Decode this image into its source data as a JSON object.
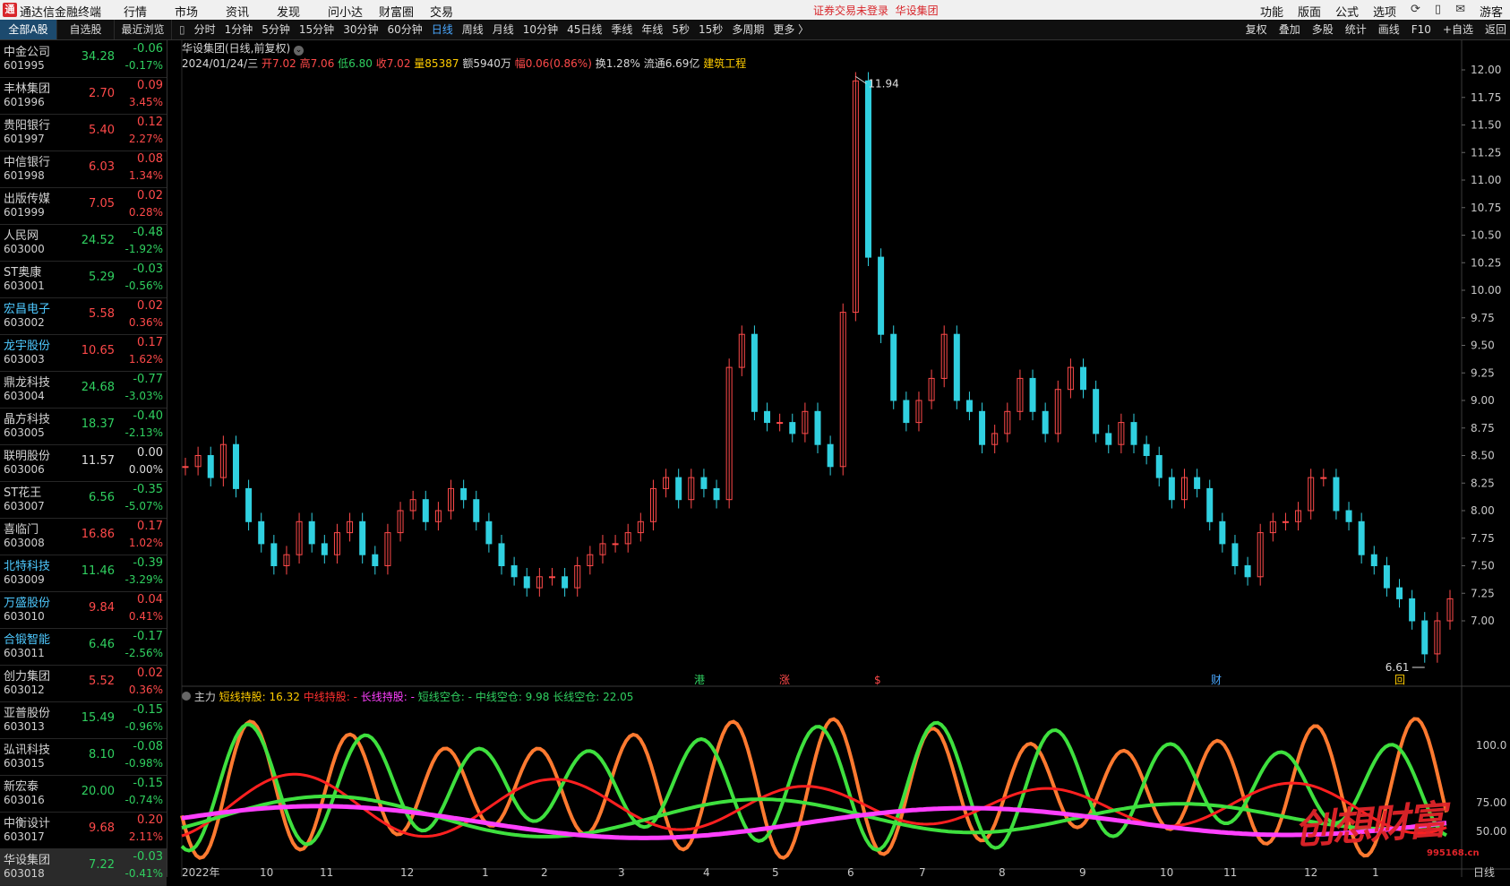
{
  "app_title": "通达信金融终端",
  "menu": [
    "行情",
    "市场",
    "资讯",
    "发现",
    "问小达",
    "财富圈",
    "交易"
  ],
  "login_notice": "证券交易未登录",
  "login_stock": "华设集团",
  "menu_right": [
    "功能",
    "版面",
    "公式",
    "选项"
  ],
  "guest_label": "游客",
  "tabs": [
    "全部A股",
    "自选股",
    "最近浏览"
  ],
  "periods": [
    "分时",
    "1分钟",
    "5分钟",
    "15分钟",
    "30分钟",
    "60分钟",
    "日线",
    "周线",
    "月线",
    "10分钟",
    "45日线",
    "季线",
    "年线",
    "5秒",
    "15秒",
    "多周期",
    "更多 〉"
  ],
  "active_period": "日线",
  "tools": [
    "复权",
    "叠加",
    "多股",
    "统计",
    "画线",
    "F10",
    "+自选",
    "返回"
  ],
  "stocks": [
    {
      "name": "中金公司",
      "code": "601995",
      "price": "34.28",
      "chg": "-0.06",
      "pct": "-0.17%",
      "dir": "dn",
      "hl": false
    },
    {
      "name": "丰林集团",
      "code": "601996",
      "price": "2.70",
      "chg": "0.09",
      "pct": "3.45%",
      "dir": "up",
      "hl": false
    },
    {
      "name": "贵阳银行",
      "code": "601997",
      "price": "5.40",
      "chg": "0.12",
      "pct": "2.27%",
      "dir": "up",
      "hl": false
    },
    {
      "name": "中信银行",
      "code": "601998",
      "price": "6.03",
      "chg": "0.08",
      "pct": "1.34%",
      "dir": "up",
      "hl": false
    },
    {
      "name": "出版传媒",
      "code": "601999",
      "price": "7.05",
      "chg": "0.02",
      "pct": "0.28%",
      "dir": "up",
      "hl": false
    },
    {
      "name": "人民网",
      "code": "603000",
      "price": "24.52",
      "chg": "-0.48",
      "pct": "-1.92%",
      "dir": "dn",
      "hl": false
    },
    {
      "name": "ST奥康",
      "code": "603001",
      "price": "5.29",
      "chg": "-0.03",
      "pct": "-0.56%",
      "dir": "dn",
      "hl": false
    },
    {
      "name": "宏昌电子",
      "code": "603002",
      "price": "5.58",
      "chg": "0.02",
      "pct": "0.36%",
      "dir": "up",
      "hl": true
    },
    {
      "name": "龙宇股份",
      "code": "603003",
      "price": "10.65",
      "chg": "0.17",
      "pct": "1.62%",
      "dir": "up",
      "hl": true
    },
    {
      "name": "鼎龙科技",
      "code": "603004",
      "price": "24.68",
      "chg": "-0.77",
      "pct": "-3.03%",
      "dir": "dn",
      "hl": false
    },
    {
      "name": "晶方科技",
      "code": "603005",
      "price": "18.37",
      "chg": "-0.40",
      "pct": "-2.13%",
      "dir": "dn",
      "hl": false
    },
    {
      "name": "联明股份",
      "code": "603006",
      "price": "11.57",
      "chg": "0.00",
      "pct": "0.00%",
      "dir": "fl",
      "hl": false
    },
    {
      "name": "ST花王",
      "code": "603007",
      "price": "6.56",
      "chg": "-0.35",
      "pct": "-5.07%",
      "dir": "dn",
      "hl": false
    },
    {
      "name": "喜临门",
      "code": "603008",
      "price": "16.86",
      "chg": "0.17",
      "pct": "1.02%",
      "dir": "up",
      "hl": false
    },
    {
      "name": "北特科技",
      "code": "603009",
      "price": "11.46",
      "chg": "-0.39",
      "pct": "-3.29%",
      "dir": "dn",
      "hl": true
    },
    {
      "name": "万盛股份",
      "code": "603010",
      "price": "9.84",
      "chg": "0.04",
      "pct": "0.41%",
      "dir": "up",
      "hl": true
    },
    {
      "name": "合锻智能",
      "code": "603011",
      "price": "6.46",
      "chg": "-0.17",
      "pct": "-2.56%",
      "dir": "dn",
      "hl": true
    },
    {
      "name": "创力集团",
      "code": "603012",
      "price": "5.52",
      "chg": "0.02",
      "pct": "0.36%",
      "dir": "up",
      "hl": false
    },
    {
      "name": "亚普股份",
      "code": "603013",
      "price": "15.49",
      "chg": "-0.15",
      "pct": "-0.96%",
      "dir": "dn",
      "hl": false
    },
    {
      "name": "弘讯科技",
      "code": "603015",
      "price": "8.10",
      "chg": "-0.08",
      "pct": "-0.98%",
      "dir": "dn",
      "hl": false
    },
    {
      "name": "新宏泰",
      "code": "603016",
      "price": "20.00",
      "chg": "-0.15",
      "pct": "-0.74%",
      "dir": "dn",
      "hl": false
    },
    {
      "name": "中衡设计",
      "code": "603017",
      "price": "9.68",
      "chg": "0.20",
      "pct": "2.11%",
      "dir": "up",
      "hl": false
    },
    {
      "name": "华设集团",
      "code": "603018",
      "price": "7.22",
      "chg": "-0.03",
      "pct": "-0.41%",
      "dir": "dn",
      "hl": false
    }
  ],
  "chart_header": "华设集团(日线,前复权)",
  "quote": {
    "date": "2024/01/24/三",
    "open": "开7.02",
    "high": "高7.06",
    "low": "低6.80",
    "close": "收7.02",
    "vol": "量85387",
    "amt": "额5940万",
    "amp": "幅0.06(0.86%)",
    "turn": "换1.28%",
    "float": "流通6.69亿",
    "sector": "建筑工程"
  },
  "indicator": {
    "name": "主力",
    "short_hold": "短线持股: 16.32",
    "mid_hold": "中线持股: -",
    "long_hold": "长线持股: -",
    "short_empty": "短线空仓: -",
    "mid_empty": "中线空仓: 9.98",
    "long_empty": "长线空仓: 22.05"
  },
  "price_labels": [
    "12.00",
    "11.75",
    "11.50",
    "11.25",
    "11.00",
    "10.75",
    "10.50",
    "10.25",
    "10.00",
    "9.75",
    "9.50",
    "9.25",
    "9.00",
    "8.75",
    "8.50",
    "8.25",
    "8.00",
    "7.75",
    "7.50",
    "7.25",
    "7.00"
  ],
  "ind_labels": [
    "100.0",
    "75.00",
    "50.00"
  ],
  "x_labels": [
    "2022年",
    "10",
    "11",
    "12",
    "1",
    "2",
    "3",
    "4",
    "5",
    "6",
    "7",
    "8",
    "9",
    "10",
    "11",
    "12",
    "1"
  ],
  "high_marker": "11.94",
  "low_marker": "6.61",
  "event_markers": [
    {
      "t": "港",
      "c": "#30d060"
    },
    {
      "t": "涨",
      "c": "#ff4a4a"
    },
    {
      "t": "$",
      "c": "#ff4a4a"
    },
    {
      "t": "财",
      "c": "#4aa8ff"
    },
    {
      "t": "回",
      "c": "#ffcc00"
    }
  ],
  "bottom_label": "日线",
  "watermark": "创想财富",
  "watermark_url": "995168.cn",
  "colors": {
    "up": "#ff4a4a",
    "down": "#30d0e0",
    "green": "#3ee03e",
    "orange": "#ff7a30",
    "red": "#ff2020",
    "magenta": "#ff40ff"
  },
  "chart_data": {
    "type": "candlestick",
    "ylim": [
      6.5,
      12.1
    ],
    "closes": [
      8.4,
      8.5,
      8.3,
      8.6,
      8.2,
      7.9,
      7.7,
      7.5,
      7.6,
      7.9,
      7.7,
      7.6,
      7.8,
      7.9,
      7.6,
      7.5,
      7.8,
      8.0,
      8.1,
      7.9,
      8.0,
      8.2,
      8.1,
      7.9,
      7.7,
      7.5,
      7.4,
      7.3,
      7.4,
      7.4,
      7.3,
      7.5,
      7.6,
      7.7,
      7.7,
      7.8,
      7.9,
      8.2,
      8.3,
      8.1,
      8.3,
      8.2,
      8.1,
      9.3,
      9.6,
      8.9,
      8.8,
      8.8,
      8.7,
      8.9,
      8.6,
      8.4,
      9.8,
      11.9,
      10.3,
      9.6,
      9.0,
      8.8,
      9.0,
      9.2,
      9.6,
      9.0,
      8.9,
      8.6,
      8.7,
      8.9,
      9.2,
      8.9,
      8.7,
      9.1,
      9.3,
      9.1,
      8.7,
      8.6,
      8.8,
      8.6,
      8.5,
      8.3,
      8.1,
      8.3,
      8.2,
      7.9,
      7.7,
      7.5,
      7.4,
      7.8,
      7.9,
      7.9,
      8.0,
      8.3,
      8.3,
      8.0,
      7.9,
      7.6,
      7.5,
      7.3,
      7.2,
      7.0,
      6.7,
      7.0,
      7.2
    ]
  }
}
